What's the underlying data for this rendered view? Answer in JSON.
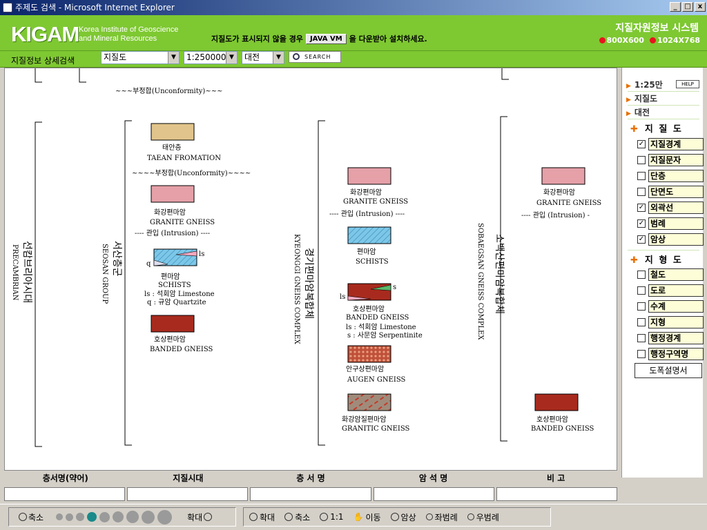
{
  "window": {
    "title": "주제도 검색 - Microsoft Internet Explorer",
    "min": "_",
    "max": "□",
    "close": "x"
  },
  "header": {
    "logo": "KIGAM",
    "logo_sub1": "Korea Institute of Geoscience",
    "logo_sub2": "and Mineral Resources",
    "java_msg_pre": "지질도가 표시되지 않을 경우",
    "java_btn": "JAVA VM",
    "java_msg_post": "을 다운받아 설치하세요.",
    "system_title": "지질자원정보 시스템",
    "res1": "800X600",
    "res2": "1024X768"
  },
  "search": {
    "label": "지질정보 상세검색",
    "map_type": "지질도",
    "scale": "1:250000",
    "region": "대전",
    "button": "SEARCH"
  },
  "legend": {
    "unconf_top": "~~~부정합(Unconformity)~~~",
    "groups": [
      {
        "ko": "선캄브리아시대",
        "en": "PRECAMBRIAN"
      },
      {
        "ko": "서산층군",
        "en": "SEOSAN GROUP"
      },
      {
        "ko": "경기편마암복합체",
        "en": "KYEONGGI GNEISS COMPLEX"
      },
      {
        "ko": "소백산편마암복합체",
        "en": "SOBAEGSAN GNEISS COMPLEX"
      }
    ],
    "col2": {
      "taean_ko": "태안층",
      "taean_en": "TAEAN FROMATION",
      "unconf": "~~~~부정합(Unconformity)~~~~",
      "granite_ko": "화강편마암",
      "granite_en": "GRANITE GNEISS",
      "intrusion": "---- 관입 (Intrusion) ----",
      "ls": "ls",
      "q": "q",
      "schist_ko": "편마암",
      "schist_en": "SCHISTS",
      "ls_note": "ls : 석회암 Limestone",
      "q_note": "q : 규암 Quartzite",
      "banded_ko": "호상편마암",
      "banded_en": "BANDED GNEISS"
    },
    "col3": {
      "granite_ko": "화강편마암",
      "granite_en": "GRANITE GNEISS",
      "intrusion": "---- 관입 (Intrusion) ----",
      "schist_ko": "편마암",
      "schist_en": "SCHISTS",
      "s": "s",
      "ls": "ls",
      "banded_ko": "호상편마암",
      "banded_en": "BANDED GNEISS",
      "ls_note": "ls : 석회암 Limestone",
      "s_note": "s : 사문암 Serpentinite",
      "augen_ko": "안구상편마암",
      "augen_en": "AUGEN GNEISS",
      "granitic_ko": "화강암질편마암",
      "granitic_en": "GRANITIC GNEISS"
    },
    "col4": {
      "granite_ko": "화강편마암",
      "granite_en": "GRANITE GNEISS",
      "intrusion": "---- 관입 (Intrusion) -",
      "banded_ko": "호상편마암",
      "banded_en": "BANDED GNEISS"
    },
    "colors": {
      "taean": "#e1c48b",
      "granite": "#e5a0a8",
      "schist": "#7cc7e8",
      "banded": "#a82a1e",
      "augen": "#c0503a",
      "granitic": "#a08b7b"
    }
  },
  "table": {
    "columns": [
      "층서명(약어)",
      "지질시대",
      "층 서 명",
      "암 석 명",
      "비 고"
    ]
  },
  "toolbar": {
    "zoom_out": "축소",
    "zoom_in": "확대",
    "zoom_levels": 9,
    "zoom_active": 4,
    "tools": [
      "확대",
      "축소",
      "1:1",
      "이동",
      "암상",
      "좌범례",
      "우범례"
    ]
  },
  "side": {
    "links": [
      "1:25만",
      "지질도",
      "대전"
    ],
    "help": "HELP",
    "section1": "지 질 도",
    "layers1": [
      {
        "label": "지질경계",
        "checked": true
      },
      {
        "label": "지질문자",
        "checked": false
      },
      {
        "label": "단층",
        "checked": false
      },
      {
        "label": "단면도",
        "checked": false
      },
      {
        "label": "외곽선",
        "checked": true
      },
      {
        "label": "범례",
        "checked": true
      },
      {
        "label": "암상",
        "checked": true
      }
    ],
    "section2": "지 형 도",
    "layers2": [
      {
        "label": "철도",
        "checked": false
      },
      {
        "label": "도로",
        "checked": false
      },
      {
        "label": "수계",
        "checked": false
      },
      {
        "label": "지형",
        "checked": false
      },
      {
        "label": "행정경계",
        "checked": false
      },
      {
        "label": "행정구역명",
        "checked": false
      }
    ],
    "pdf_button": "도폭설명서"
  }
}
